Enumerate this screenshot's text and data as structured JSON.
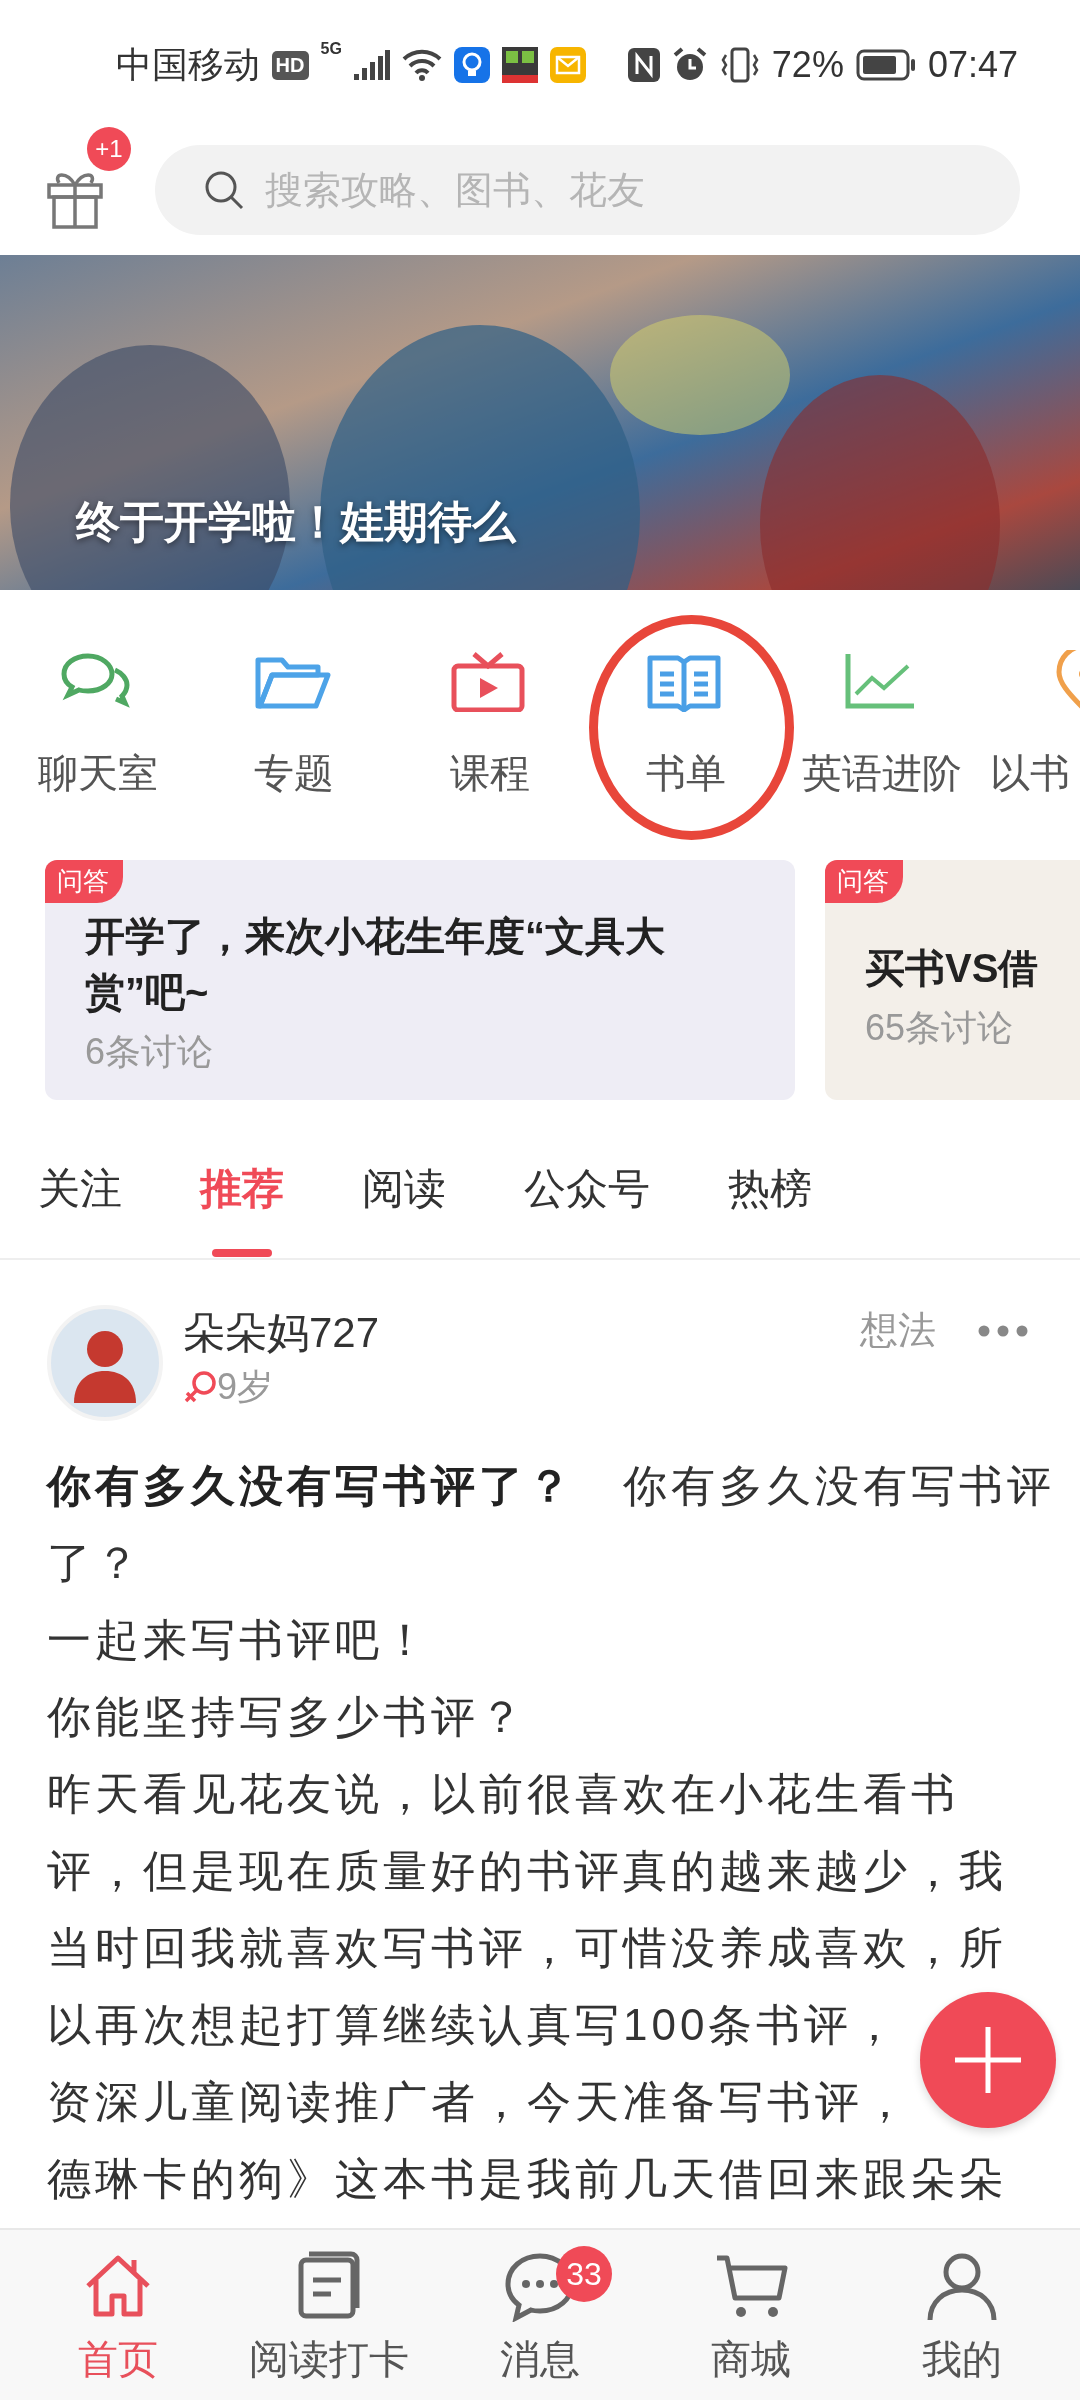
{
  "status_bar": {
    "carrier": "中国移动",
    "hd": "HD",
    "network": "5G",
    "battery": "72%",
    "time": "07:47"
  },
  "top_bar": {
    "gift_badge": "+1",
    "search": {
      "placeholder": "搜索攻略、图书、花友"
    }
  },
  "banner": {
    "caption": "终于开学啦！娃期待么"
  },
  "shortcuts": [
    {
      "kind": "chat",
      "label": "聊天室",
      "color": "#4fa862",
      "highlighted": false
    },
    {
      "kind": "folder",
      "label": "专题",
      "color": "#4da3e8",
      "highlighted": false
    },
    {
      "kind": "tv",
      "label": "课程",
      "color": "#e8505b",
      "highlighted": false
    },
    {
      "kind": "book",
      "label": "书单",
      "color": "#4a9fe6",
      "highlighted": true
    },
    {
      "kind": "chart",
      "label": "英语进阶",
      "color": "#66c07a",
      "highlighted": false
    },
    {
      "kind": "pin",
      "label": "以书",
      "color": "#f0a04b",
      "highlighted": false
    }
  ],
  "qa_cards": [
    {
      "tag": "问答",
      "title": "开学了，来次小花生年度“文具大赏”吧~",
      "count": "6条讨论",
      "color": "#eeedf5"
    },
    {
      "tag": "问答",
      "title": "买书VS借",
      "count": "65条讨论",
      "color": "#f3efe9"
    }
  ],
  "tabs": [
    {
      "label": "关注",
      "selected": false
    },
    {
      "label": "推荐",
      "selected": true
    },
    {
      "label": "阅读",
      "selected": false
    },
    {
      "label": "公众号",
      "selected": false
    },
    {
      "label": "热榜",
      "selected": false
    }
  ],
  "post": {
    "author": "朵朵妈727",
    "age": "9岁",
    "type": "想法",
    "lines": [
      "**你有多久没有写书评了？**　你有多久没有写书评",
      "了？",
      "一起来写书评吧！",
      "你能坚持写多少书评？",
      "昨天看见花友说，以前很喜欢在小花生看书",
      "评，但是现在质量好的书评真的越来越少，我",
      "当时回我就喜欢写书评，可惜没养成喜欢，所",
      "以再次想起打算继续认真写100条书评，",
      "资深儿童阅读推广者，今天准备写书评，",
      "德琳卡的狗》这本书是我前几天借回来跟朵朵"
    ]
  },
  "bottom_nav": [
    {
      "kind": "home",
      "label": "首页",
      "selected": true
    },
    {
      "kind": "note",
      "label": "阅读打卡",
      "selected": false
    },
    {
      "kind": "message",
      "label": "消息",
      "selected": false,
      "badge": "33"
    },
    {
      "kind": "cart",
      "label": "商城",
      "selected": false
    },
    {
      "kind": "person",
      "label": "我的",
      "selected": false
    }
  ]
}
